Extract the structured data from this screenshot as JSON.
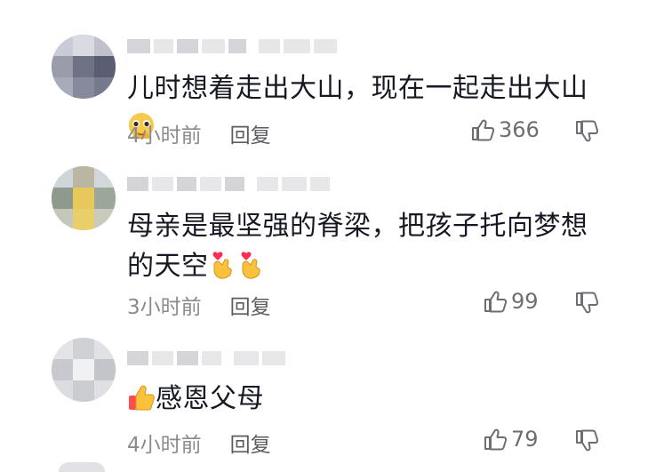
{
  "comments": [
    {
      "text": "儿时想着走出大山，现在一起走出大山",
      "emoji": [
        "pleading-hands-emoji"
      ],
      "time": "4小时前",
      "reply": "回复",
      "likes": "366"
    },
    {
      "text": "母亲是最坚强的脊梁，把孩子托向梦想的天空",
      "emoji": [
        "finger-heart-emoji",
        "finger-heart-emoji"
      ],
      "time": "3小时前",
      "reply": "回复",
      "likes": "99"
    },
    {
      "text": "感恩父母",
      "emoji": [
        "thumbs-up-emoji"
      ],
      "time": "4小时前",
      "reply": "回复",
      "likes": "79"
    }
  ],
  "colors": {
    "text": "#161823",
    "meta": "#8a8b91",
    "blur": "#e7e7ea"
  }
}
